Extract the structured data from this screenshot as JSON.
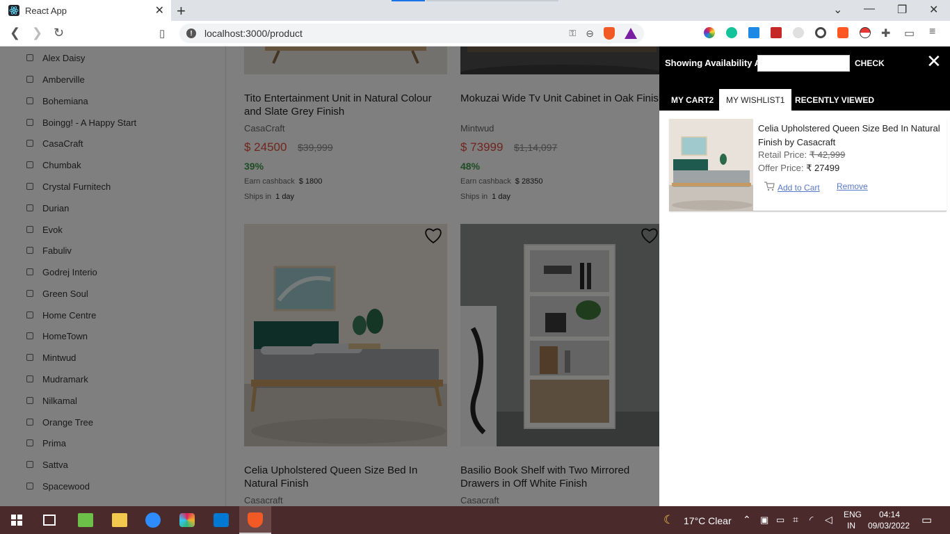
{
  "browser": {
    "tab_title": "React App",
    "url": "localhost:3000/product"
  },
  "sidebar": {
    "brands": [
      "Alex Daisy",
      "Amberville",
      "Bohemiana",
      "Boingg! - A Happy Start",
      "CasaCraft",
      "Chumbak",
      "Crystal Furnitech",
      "Durian",
      "Evok",
      "Fabuliv",
      "Godrej Interio",
      "Green Soul",
      "Home Centre",
      "HomeTown",
      "Mintwud",
      "Mudramark",
      "Nilkamal",
      "Orange Tree",
      "Prima",
      "Sattva",
      "Spacewood"
    ]
  },
  "products": [
    {
      "name": "Tito Entertainment Unit in Natural Colour and Slate Grey Finish",
      "brand": "CasaCraft",
      "price": "$ 24500",
      "mrp": "$39,999",
      "discount": "39%",
      "cashback_label": "Earn cashback",
      "cashback": "$ 1800",
      "ships_label": "Ships in",
      "ships": "1 day"
    },
    {
      "name": "Mokuzai Wide Tv Unit Cabinet in Oak Finish",
      "brand": "Mintwud",
      "price": "$ 73999",
      "mrp": "$1,14,097",
      "discount": "48%",
      "cashback_label": "Earn cashback",
      "cashback": "$ 28350",
      "ships_label": "Ships in",
      "ships": "1 day"
    },
    {
      "name": "Celia Upholstered Queen Size Bed In Natural Finish",
      "brand": "Casacraft"
    },
    {
      "name": "Basilio Book Shelf with Two Mirrored Drawers in Off White Finish",
      "brand": "Casacraft"
    }
  ],
  "drawer": {
    "availability_label": "Showing Availability At",
    "pincode_value": "",
    "check_label": "CHECK",
    "close_label": "X",
    "tabs": [
      "MY CART2",
      "MY WISHLIST1",
      "RECENTLY VIEWED"
    ],
    "wishlist_item": {
      "name": "Celia Upholstered Queen Size Bed In Natural Finish by Casacraft",
      "retail_label": "Retail Price:",
      "retail_price": "₹ 42,999",
      "offer_label": "Offer Price:",
      "offer_price": "₹ 27499",
      "add_to_cart": "Add to Cart",
      "remove": "Remove"
    }
  },
  "taskbar": {
    "weather": "17°C  Clear",
    "lang": "ENG",
    "region": "IN",
    "time": "04:14",
    "date": "09/03/2022"
  }
}
